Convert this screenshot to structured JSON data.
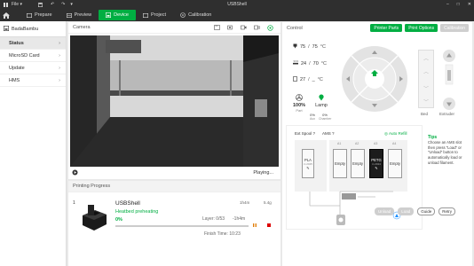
{
  "titlebar": {
    "file_label": "File",
    "title": "USBShell"
  },
  "tabs": [
    {
      "label": "Prepare"
    },
    {
      "label": "Preview"
    },
    {
      "label": "Device"
    },
    {
      "label": "Project"
    },
    {
      "label": "Calibration"
    }
  ],
  "sidebar": {
    "printer_name": "BadaBambu",
    "items": [
      {
        "label": "Status"
      },
      {
        "label": "MicroSD Card"
      },
      {
        "label": "Update"
      },
      {
        "label": "HMS"
      }
    ]
  },
  "camera": {
    "title": "Camera",
    "status": "Playing..."
  },
  "progress": {
    "title": "Printing Progress",
    "plate_number": "1",
    "job_name": "USBShell",
    "status": "Heatbed preheating",
    "time_label": "1h4m",
    "weight_label": "5.4g",
    "percent": "0%",
    "percent_value": 0,
    "layer": "Layer: 0/53",
    "remaining": "-1h4m",
    "finish_time": "Finish Time: 10:23"
  },
  "control": {
    "title": "Control",
    "buttons": {
      "printer_parts": "Printer Parts",
      "print_options": "Print Options",
      "calibration": "Calibration"
    },
    "temps": [
      {
        "current": "75",
        "target": "75",
        "unit": "°C"
      },
      {
        "current": "24",
        "target": "70",
        "unit": "°C"
      },
      {
        "current": "27",
        "target": "_",
        "unit": "°C"
      }
    ],
    "fan_part": {
      "value": "100%",
      "label": "Part"
    },
    "lamp": {
      "label": "Lamp"
    },
    "fans_small": [
      {
        "value": "0%",
        "label": "Aux"
      },
      {
        "value": "0%",
        "label": "Chamber"
      }
    ],
    "bed_label": "Bed",
    "extruder_label": "Extruder",
    "ext_spool_label": "Ext Spool",
    "ams_label": "AMS",
    "auto_refill_label": "Auto Refill",
    "ext_spool": {
      "type": "PLA",
      "sub": "in 2025"
    },
    "ams_slots": [
      {
        "id": "A1",
        "label": "Empty"
      },
      {
        "id": "A2",
        "label": "Empty"
      },
      {
        "id": "A3",
        "label": "PETG",
        "sub": "in 2024"
      },
      {
        "id": "A4",
        "label": "Empty"
      }
    ],
    "tips_title": "Tips",
    "tips_text": "Choose an AMS slot then press \"Load\" or \"Unload\" button to automatically load or unload filament.",
    "unload_label": "Unload",
    "load_label": "Load",
    "guide_label": "Guide",
    "retry_label": "Retry",
    "accent": "#00ae42"
  }
}
